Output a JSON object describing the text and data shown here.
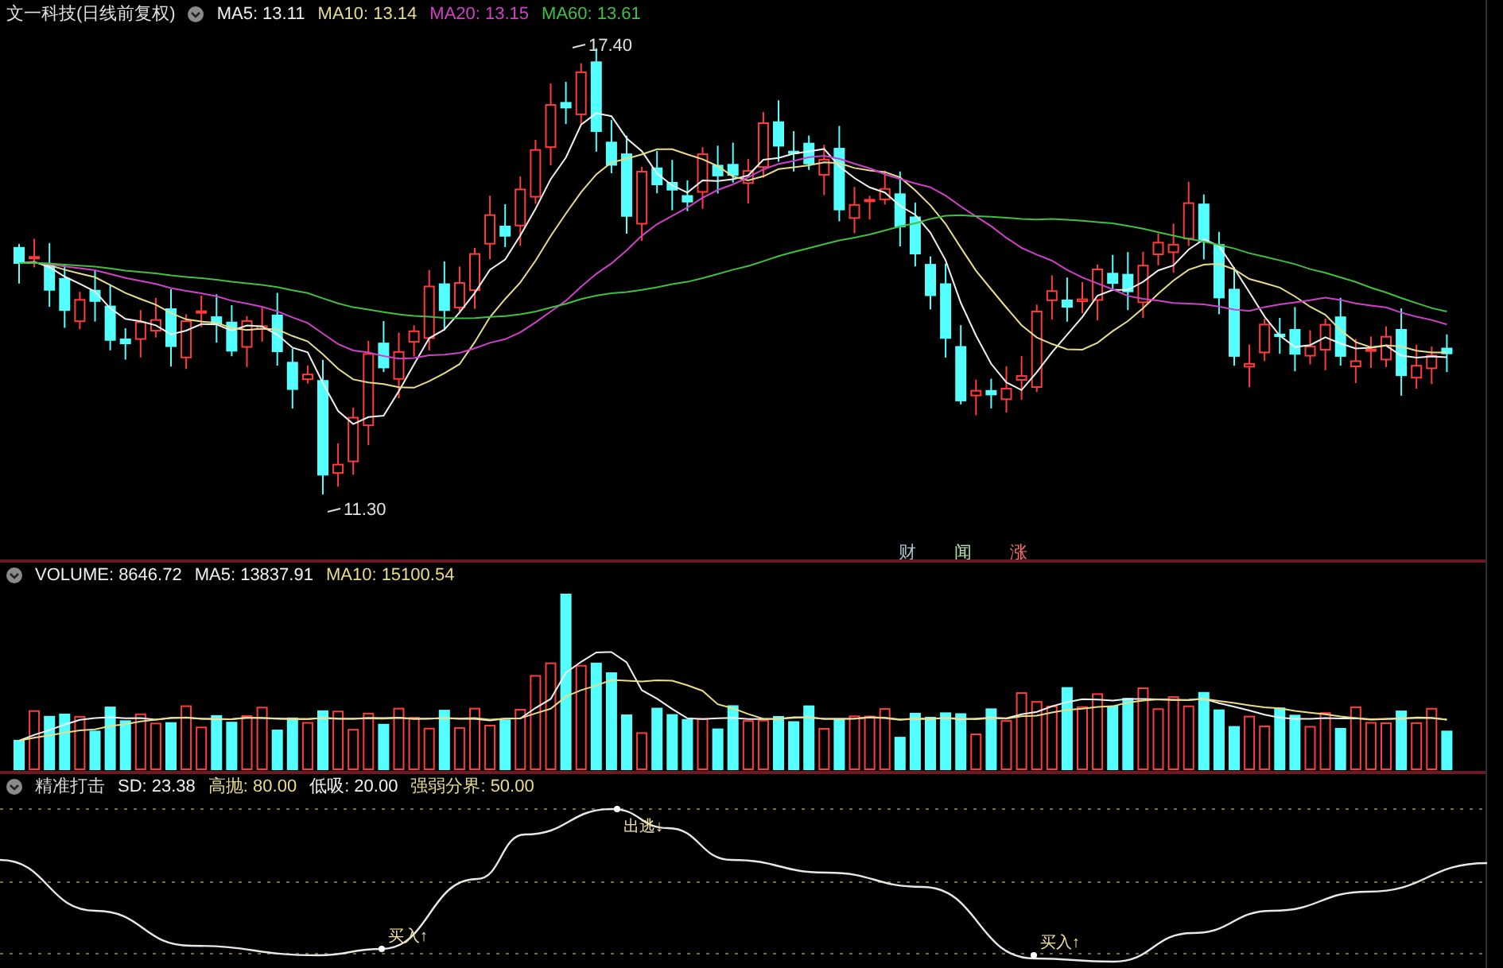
{
  "price_panel": {
    "title": "文一科技(日线前复权)",
    "indicators": [
      {
        "label": "MA5: 13.11",
        "color": "#f0f0f0"
      },
      {
        "label": "MA10: 13.14",
        "color": "#e8dc8c"
      },
      {
        "label": "MA20: 13.15",
        "color": "#d040c8"
      },
      {
        "label": "MA60: 13.61",
        "color": "#40c040"
      }
    ],
    "high_marker": "17.40",
    "low_marker": "11.30",
    "event_markers": [
      {
        "label": "财",
        "color": "#a8c0d0"
      },
      {
        "label": "闻",
        "color": "#b8e0b0"
      },
      {
        "label": "涨",
        "color": "#ff7070"
      }
    ]
  },
  "volume_panel": {
    "indicators": [
      {
        "label": "VOLUME: 8646.72",
        "color": "#f0f0f0"
      },
      {
        "label": "MA5: 13837.91",
        "color": "#f0f0f0"
      },
      {
        "label": "MA10: 15100.54",
        "color": "#e8dc8c"
      }
    ]
  },
  "indicator_panel": {
    "indicators": [
      {
        "label": "精准打击",
        "color": "#d8d8d8"
      },
      {
        "label": "SD: 23.38",
        "color": "#f0f0f0"
      },
      {
        "label": "高抛: 80.00",
        "color": "#e8dc8c"
      },
      {
        "label": "低吸: 20.00",
        "color": "#f0f0f0"
      },
      {
        "label": "强弱分界: 50.00",
        "color": "#e8dc8c"
      }
    ],
    "signals": [
      {
        "label": "买入↑"
      },
      {
        "label": "出逃↓"
      },
      {
        "label": "买入↑"
      }
    ]
  }
}
